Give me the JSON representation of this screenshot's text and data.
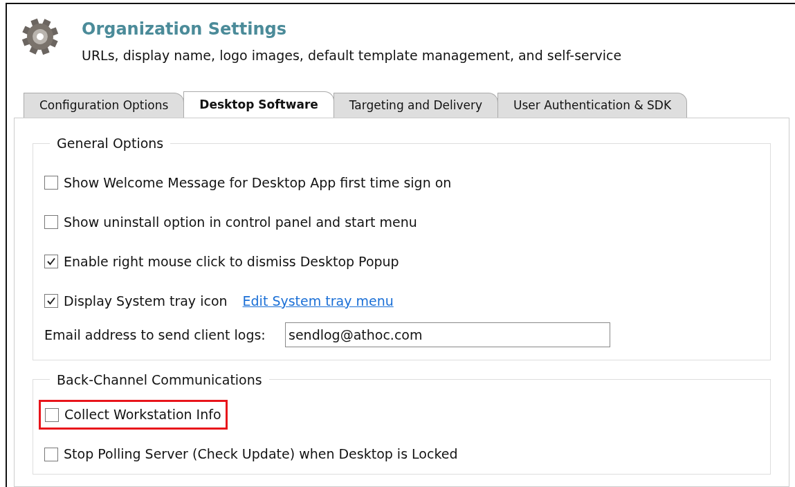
{
  "header": {
    "title": "Organization Settings",
    "subtitle": "URLs, display name, logo images, default template management, and self-service"
  },
  "tabs": [
    {
      "label": "Configuration Options",
      "selected": false
    },
    {
      "label": "Desktop Software",
      "selected": true
    },
    {
      "label": "Targeting and Delivery",
      "selected": false
    },
    {
      "label": "User Authentication & SDK",
      "selected": false
    }
  ],
  "general_options": {
    "legend": "General Options",
    "options": [
      {
        "label": "Show Welcome Message for Desktop App first time sign on",
        "checked": false
      },
      {
        "label": "Show uninstall option in control panel and start menu",
        "checked": false
      },
      {
        "label": "Enable right mouse click to dismiss Desktop Popup",
        "checked": true
      },
      {
        "label": "Display System tray icon",
        "checked": true,
        "link": "Edit System tray menu"
      }
    ],
    "email": {
      "label": "Email address to send client logs:",
      "value": "sendlog@athoc.com"
    }
  },
  "back_channel": {
    "legend": "Back-Channel Communications",
    "options": [
      {
        "label": "Collect Workstation Info",
        "checked": false,
        "highlighted": true
      },
      {
        "label": "Stop Polling Server (Check Update) when Desktop is Locked",
        "checked": false,
        "highlighted": false
      }
    ]
  }
}
